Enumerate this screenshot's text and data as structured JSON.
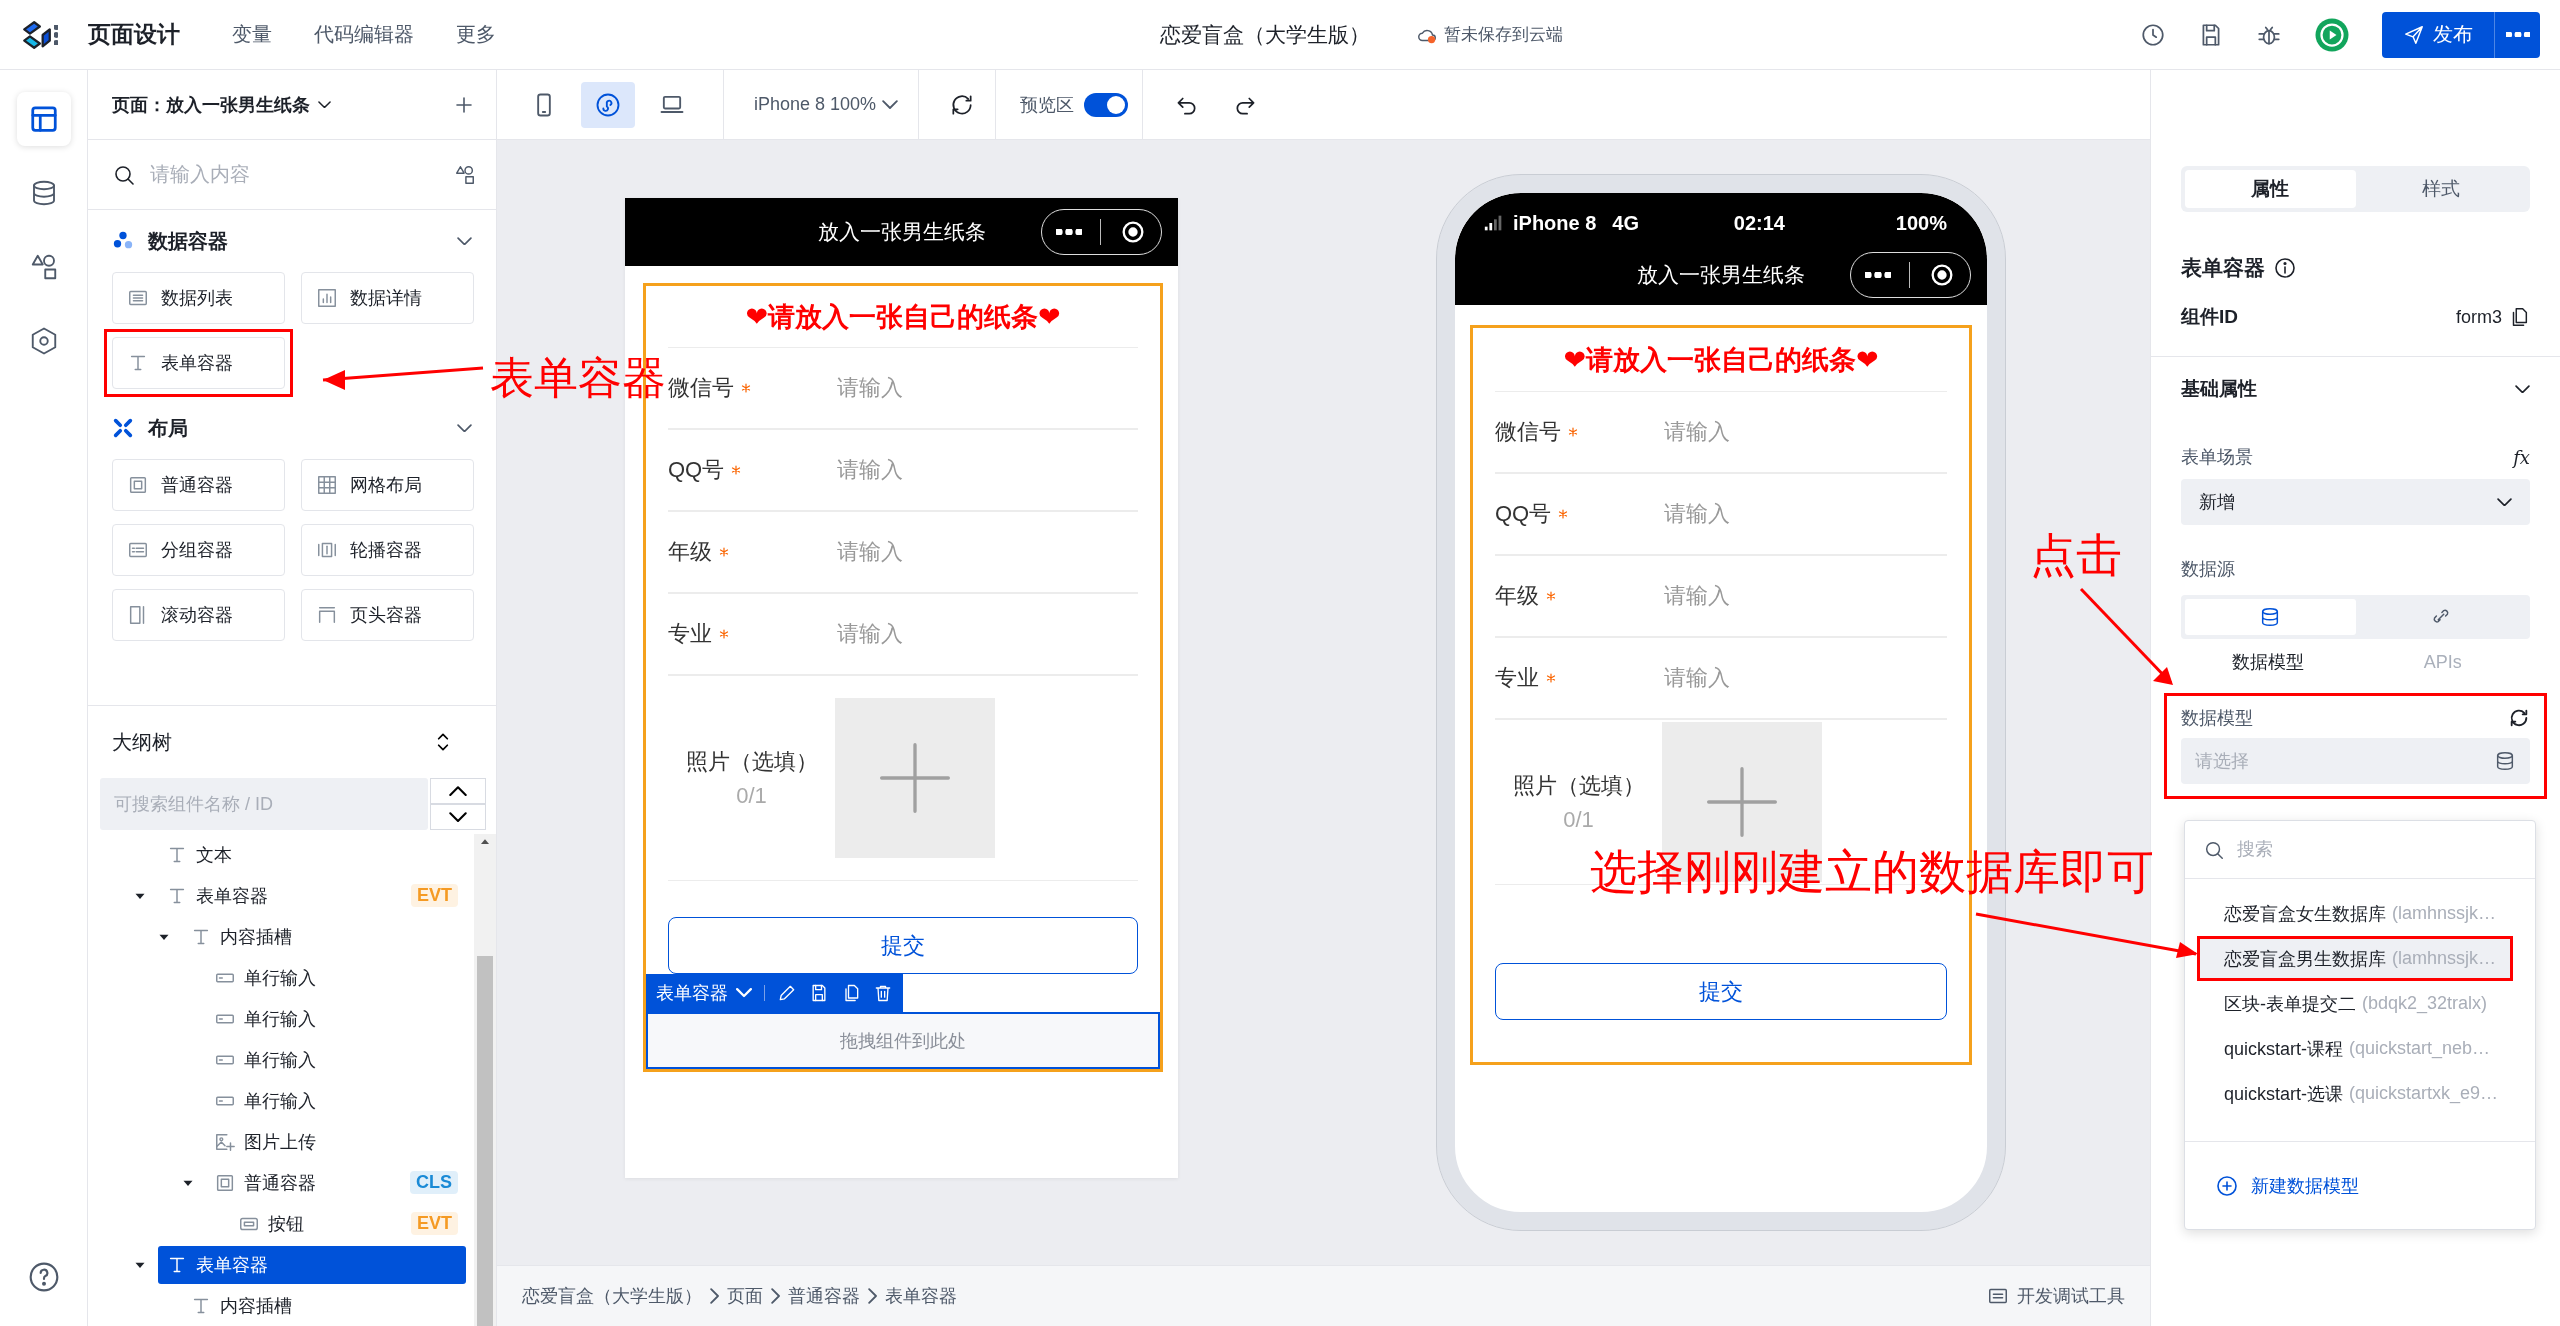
{
  "top_bar": {
    "title": "页面设计",
    "menu": [
      {
        "label": "变量"
      },
      {
        "label": "代码编辑器"
      },
      {
        "label": "更多"
      }
    ],
    "project": "恋爱盲盒（大学生版）",
    "save_status": "暂未保存到云端",
    "publish": "发布"
  },
  "side_rail": {
    "items": [
      {
        "selected": true
      },
      {
        "selected": false
      },
      {
        "selected": false
      },
      {
        "selected": false
      }
    ]
  },
  "left_panel": {
    "page": "页面：放入一张男生纸条",
    "search": {
      "placeholder": "请输入内容"
    },
    "groups": [
      {
        "title": "数据容器",
        "expanded": true,
        "items": [
          {
            "label": "数据列表",
            "highlighted": false
          },
          {
            "label": "数据详情",
            "highlighted": false
          },
          {
            "label": "表单容器",
            "highlighted": true
          }
        ]
      },
      {
        "title": "布局",
        "expanded": true,
        "items": [
          {
            "label": "普通容器",
            "highlighted": false
          },
          {
            "label": "网格布局",
            "highlighted": false
          },
          {
            "label": "分组容器",
            "highlighted": false
          },
          {
            "label": "轮播容器",
            "highlighted": false
          },
          {
            "label": "滚动容器",
            "highlighted": false
          },
          {
            "label": "页头容器",
            "highlighted": false
          }
        ]
      }
    ],
    "outline": {
      "title": "大纲树",
      "search": {
        "placeholder": "可搜索组件名称 / ID"
      },
      "tree": [
        {
          "label": "文本",
          "kind": "text",
          "selected": false
        },
        {
          "label": "表单容器",
          "kind": "text",
          "selected": false,
          "expanded": true,
          "badge": {
            "text": "EVT",
            "color": "#f59a23"
          },
          "children": [
            {
              "label": "内容插槽",
              "kind": "text",
              "selected": false,
              "expanded": true,
              "children": [
                {
                  "label": "单行输入",
                  "kind": "input",
                  "selected": false
                },
                {
                  "label": "单行输入",
                  "kind": "input",
                  "selected": false
                },
                {
                  "label": "单行输入",
                  "kind": "input",
                  "selected": false
                },
                {
                  "label": "单行输入",
                  "kind": "input",
                  "selected": false
                },
                {
                  "label": "图片上传",
                  "kind": "image",
                  "selected": false
                },
                {
                  "label": "普通容器",
                  "kind": "container",
                  "selected": false,
                  "expanded": true,
                  "badge": {
                    "text": "CLS",
                    "color": "#1a8ad6"
                  },
                  "children": [
                    {
                      "label": "按钮",
                      "kind": "button",
                      "selected": false,
                      "badge": {
                        "text": "EVT",
                        "color": "#f59a23"
                      }
                    }
                  ]
                }
              ]
            }
          ]
        },
        {
          "label": "表单容器",
          "kind": "text",
          "selected": true,
          "expanded": true,
          "children": [
            {
              "label": "内容插槽",
              "kind": "text",
              "selected": false
            }
          ]
        }
      ]
    }
  },
  "canvas": {
    "toolbar": {
      "devices": [
        {
          "selected": false
        },
        {
          "selected": true
        },
        {
          "selected": false
        }
      ],
      "device": "iPhone 8 100%",
      "preview": {
        "label": "预览区",
        "on": true
      }
    },
    "phones": [
      {
        "kind": "editor",
        "title": "放入一张男生纸条",
        "heading": "❤请放入一张自己的纸条❤",
        "fields": [
          {
            "label": "微信号",
            "required": true,
            "placeholder": "请输入"
          },
          {
            "label": "QQ号",
            "required": true,
            "placeholder": "请输入"
          },
          {
            "label": "年级",
            "required": true,
            "placeholder": "请输入"
          },
          {
            "label": "专业",
            "required": true,
            "placeholder": "请输入"
          }
        ],
        "photo": {
          "label": "照片（选填）",
          "count": "0/1"
        },
        "submit": "提交",
        "selection": {
          "label": "表单容器",
          "dropzone": "拖拽组件到此处"
        }
      },
      {
        "kind": "preview",
        "status": {
          "carrier": "iPhone 8",
          "network": "4G",
          "time": "02:14",
          "battery": "100%"
        },
        "title": "放入一张男生纸条",
        "heading": "❤请放入一张自己的纸条❤",
        "fields": [
          {
            "label": "微信号",
            "required": true,
            "placeholder": "请输入"
          },
          {
            "label": "QQ号",
            "required": true,
            "placeholder": "请输入"
          },
          {
            "label": "年级",
            "required": true,
            "placeholder": "请输入"
          },
          {
            "label": "专业",
            "required": true,
            "placeholder": "请输入"
          }
        ],
        "photo": {
          "label": "照片（选填）",
          "count": "0/1"
        },
        "submit": "提交"
      }
    ],
    "breadcrumb": [
      "恋爱盲盒（大学生版）",
      "页面",
      "普通容器",
      "表单容器"
    ],
    "devtools": "开发调试工具"
  },
  "props_panel": {
    "tabs": [
      {
        "label": "属性",
        "selected": true
      },
      {
        "label": "样式",
        "selected": false
      }
    ],
    "component_title": "表单容器",
    "id_label": "组件ID",
    "id_value": "form3",
    "section": {
      "title": "基础属性",
      "expanded": true
    },
    "scene": {
      "label": "表单场景",
      "formula": "fx",
      "value": "新增"
    },
    "datasource": {
      "label": "数据源",
      "options": [
        {
          "label": "数据模型",
          "selected": true
        },
        {
          "label": "APIs",
          "selected": false
        }
      ]
    },
    "model": {
      "label": "数据模型",
      "placeholder": "请选择",
      "highlighted": true
    },
    "dropdown": {
      "search": {
        "placeholder": "搜索"
      },
      "options": [
        {
          "name": "恋爱盲盒女生数据库",
          "id": "(lamhnssjk…",
          "selected": false,
          "highlighted": false
        },
        {
          "name": "恋爱盲盒男生数据库",
          "id": "(lamhnssjk…",
          "selected": true,
          "highlighted": true
        },
        {
          "name": "区块-表单提交二",
          "id": "(bdqk2_32tralx)",
          "selected": false,
          "highlighted": false
        },
        {
          "name": "quickstart-课程",
          "id": "(quickstart_neb…",
          "selected": false,
          "highlighted": false
        },
        {
          "name": "quickstart-选课",
          "id": "(quickstartxk_e9…",
          "selected": false,
          "highlighted": false
        }
      ],
      "create": "新建数据模型"
    }
  },
  "annotations": [
    {
      "kind": "palette",
      "text": "表单容器"
    },
    {
      "kind": "click",
      "text": "点击"
    },
    {
      "kind": "model",
      "text": "选择刚刚建立的数据库即可"
    }
  ]
}
